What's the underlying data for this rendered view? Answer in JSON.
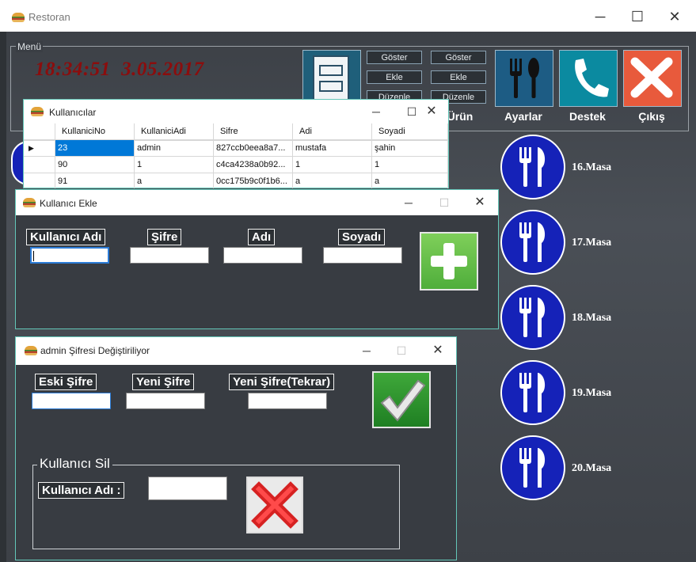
{
  "main": {
    "title": "Restoran",
    "menu_legend": "Menü",
    "time": "18:34:51",
    "date": "3.05.2017",
    "button_col1": [
      "Göster",
      "Ekle",
      "Düzenle"
    ],
    "button_col2": [
      "Göster",
      "Ekle",
      "Düzenle"
    ],
    "labels": {
      "urun": "Ürün",
      "ayarlar": "Ayarlar",
      "destek": "Destek",
      "cikis": "Çıkış"
    }
  },
  "tables": [
    {
      "label": "16.Masa"
    },
    {
      "label": "17.Masa"
    },
    {
      "label": "18.Masa"
    },
    {
      "label": "19.Masa"
    },
    {
      "label": "20.Masa"
    }
  ],
  "users_window": {
    "title": "Kullanıcılar",
    "columns": [
      "KullaniciNo",
      "KullaniciAdi",
      "Sifre",
      "Adi",
      "Soyadi"
    ],
    "rows": [
      [
        "23",
        "admin",
        "827ccb0eea8a7...",
        "mustafa",
        "şahin"
      ],
      [
        "90",
        "1",
        "c4ca4238a0b92...",
        "1",
        "1"
      ],
      [
        "91",
        "a",
        "0cc175b9c0f1b6...",
        "a",
        "a"
      ]
    ]
  },
  "add_user_window": {
    "title": "Kullanıcı Ekle",
    "labels": [
      "Kullanıcı Adı",
      "Şifre",
      "Adı",
      "Soyadı"
    ]
  },
  "change_password_window": {
    "title": "admin Şifresi Değiştiriliyor",
    "labels": [
      "Eski Şifre",
      "Yeni Şifre",
      "Yeni Şifre(Tekrar)"
    ],
    "delete_group": "Kullanıcı Sil",
    "delete_label": "Kullanıcı Adı :"
  },
  "colors": {
    "clock": "#8b0d0d",
    "table_circle": "#1522b8",
    "dialog_border": "#63c6b8",
    "add_green": "#4fae3b",
    "delete_red": "#d62222"
  }
}
